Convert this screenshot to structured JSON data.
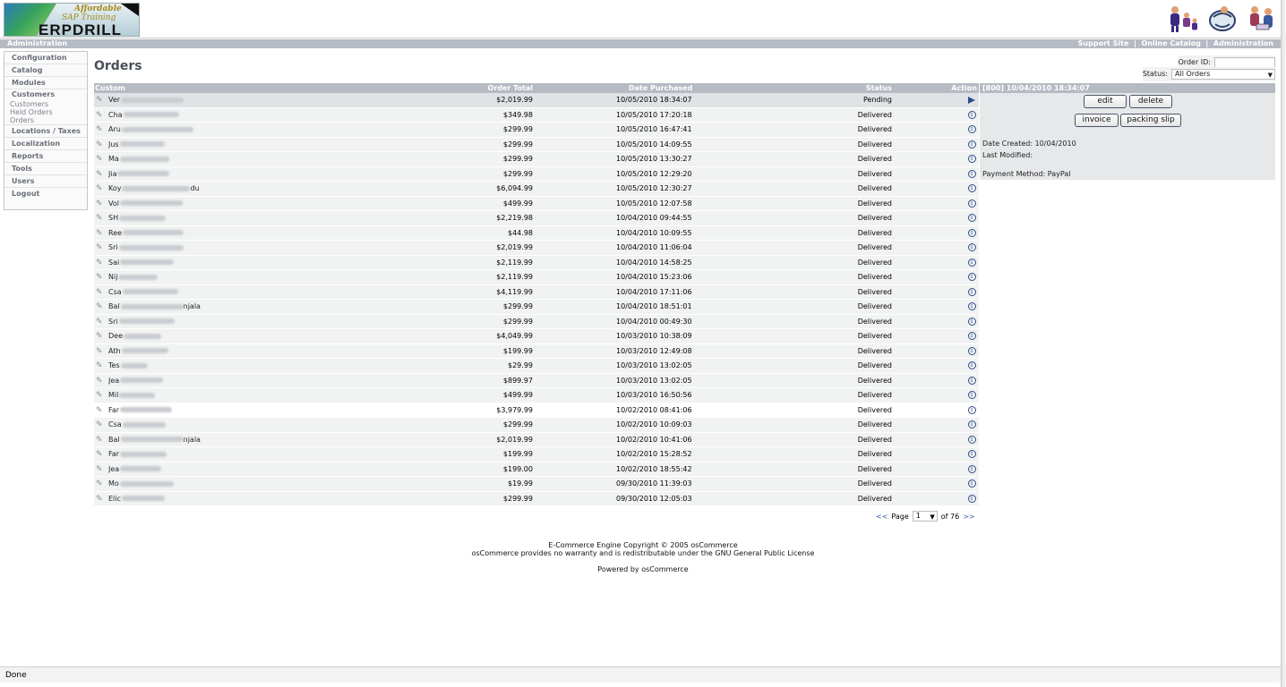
{
  "header": {
    "logo_line1": "Affordable",
    "logo_line2": "SAP Training",
    "logo_line3": "ERPDRILL",
    "icons": [
      "family-icon",
      "globe-icon",
      "people-icon"
    ]
  },
  "topbar": {
    "left": "Administration",
    "links": [
      "Support Site",
      "Online Catalog",
      "Administration"
    ],
    "sep": "|"
  },
  "sidebar": {
    "items": [
      {
        "label": "Configuration"
      },
      {
        "label": "Catalog"
      },
      {
        "label": "Modules"
      },
      {
        "label": "Customers"
      }
    ],
    "subitems": [
      "Customers",
      "Held Orders",
      "Orders"
    ],
    "items2": [
      {
        "label": "Locations / Taxes"
      },
      {
        "label": "Localization"
      },
      {
        "label": "Reports"
      },
      {
        "label": "Tools"
      },
      {
        "label": "Users"
      },
      {
        "label": "Logout"
      }
    ]
  },
  "page": {
    "title": "Orders",
    "order_id_label": "Order ID:",
    "status_label": "Status:",
    "status_value": "All Orders"
  },
  "table": {
    "headers": {
      "customer": "Custom",
      "total": "Order Total",
      "date": "Date Purchased",
      "status": "Status",
      "action": "Action"
    },
    "rows": [
      {
        "name": "Ver",
        "total": "$2,019.99",
        "date": "10/05/2010 18:34:07",
        "status": "Pending"
      },
      {
        "name": "Cha",
        "total": "$349.98",
        "date": "10/05/2010 17:20:18",
        "status": "Delivered"
      },
      {
        "name": "Aru",
        "total": "$299.99",
        "date": "10/05/2010 16:47:41",
        "status": "Delivered"
      },
      {
        "name": "Jus",
        "total": "$299.99",
        "date": "10/05/2010 14:09:55",
        "status": "Delivered"
      },
      {
        "name": "Ma",
        "total": "$299.99",
        "date": "10/05/2010 13:30:27",
        "status": "Delivered"
      },
      {
        "name": "Jia",
        "total": "$299.99",
        "date": "10/05/2010 12:29:20",
        "status": "Delivered"
      },
      {
        "name": "Koy",
        "suffix": "du",
        "total": "$6,094.99",
        "date": "10/05/2010 12:30:27",
        "status": "Delivered"
      },
      {
        "name": "Vol",
        "total": "$499.99",
        "date": "10/05/2010 12:07:58",
        "status": "Delivered"
      },
      {
        "name": "SH",
        "total": "$2,219.98",
        "date": "10/04/2010 09:44:55",
        "status": "Delivered"
      },
      {
        "name": "Ree",
        "total": "$44.98",
        "date": "10/04/2010 10:09:55",
        "status": "Delivered"
      },
      {
        "name": "Sri",
        "total": "$2,019.99",
        "date": "10/04/2010 11:06:04",
        "status": "Delivered"
      },
      {
        "name": "Sai",
        "total": "$2,119.99",
        "date": "10/04/2010 14:58:25",
        "status": "Delivered"
      },
      {
        "name": "Nij",
        "total": "$2,119.99",
        "date": "10/04/2010 15:23:06",
        "status": "Delivered"
      },
      {
        "name": "Csa",
        "total": "$4,119.99",
        "date": "10/04/2010 17:11:06",
        "status": "Delivered"
      },
      {
        "name": "Bal",
        "suffix": "njala",
        "total": "$299.99",
        "date": "10/04/2010 18:51:01",
        "status": "Delivered"
      },
      {
        "name": "Sri",
        "total": "$299.99",
        "date": "10/04/2010 00:49:30",
        "status": "Delivered"
      },
      {
        "name": "Dee",
        "total": "$4,049.99",
        "date": "10/03/2010 10:38:09",
        "status": "Delivered"
      },
      {
        "name": "Ath",
        "total": "$199.99",
        "date": "10/03/2010 12:49:08",
        "status": "Delivered"
      },
      {
        "name": "Tes",
        "total": "$29.99",
        "date": "10/03/2010 13:02:05",
        "status": "Delivered"
      },
      {
        "name": "Jea",
        "total": "$899.97",
        "date": "10/03/2010 13:02:05",
        "status": "Delivered"
      },
      {
        "name": "Mil",
        "total": "$499.99",
        "date": "10/03/2010 16:50:56",
        "status": "Delivered"
      },
      {
        "name": "Far",
        "total": "$3,979.99",
        "date": "10/02/2010 08:41:06",
        "status": "Delivered"
      },
      {
        "name": "Csa",
        "total": "$299.99",
        "date": "10/02/2010 10:09:03",
        "status": "Delivered"
      },
      {
        "name": "Bal",
        "suffix": "njala",
        "total": "$2,019.99",
        "date": "10/02/2010 10:41:06",
        "status": "Delivered"
      },
      {
        "name": "Far",
        "total": "$199.99",
        "date": "10/02/2010 15:28:52",
        "status": "Delivered"
      },
      {
        "name": "Jea",
        "total": "$199.00",
        "date": "10/02/2010 18:55:42",
        "status": "Delivered"
      },
      {
        "name": "Mo",
        "total": "$19.99",
        "date": "09/30/2010 11:39:03",
        "status": "Delivered"
      },
      {
        "name": "Elic",
        "total": "$299.99",
        "date": "09/30/2010 12:05:03",
        "status": "Delivered"
      }
    ]
  },
  "pager": {
    "prev": "<<",
    "page_label": "Page",
    "page_value": "1",
    "of_label": "of 76",
    "next": ">>"
  },
  "detail": {
    "header": "[800]  10/04/2010 18:34:07",
    "edit": "edit",
    "delete": "delete",
    "invoice": "invoice",
    "packing_slip": "packing slip",
    "date_created": "Date Created: 10/04/2010",
    "last_modified": "Last Modified:",
    "payment_method": "Payment Method: PayPal"
  },
  "footer": {
    "line1": "E-Commerce Engine Copyright © 2005 osCommerce",
    "line2": "osCommerce provides no warranty and is redistributable under the GNU General Public License",
    "line3": "Powered by osCommerce"
  },
  "statusbar": {
    "text": "Done"
  }
}
